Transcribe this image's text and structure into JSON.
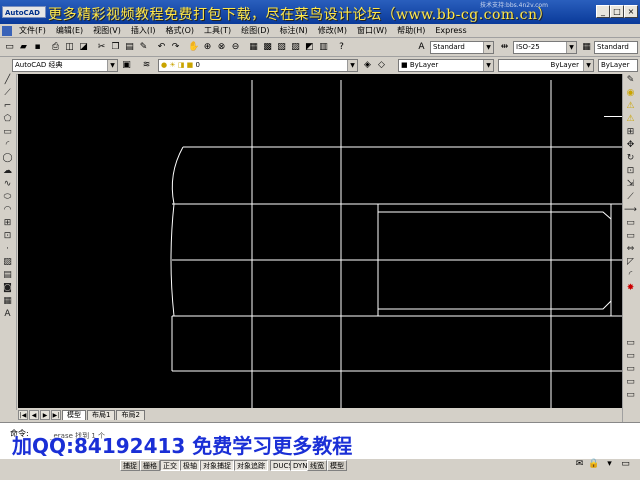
{
  "app": {
    "logo": "AutoCAD",
    "banner": "更多精彩视频教程免费打包下载，尽在菜鸟设计论坛（www.bb-cg.com.cn）",
    "watermark_top": "技术支持:bbs.4n2v.com",
    "window_buttons": [
      "_",
      "□",
      "×"
    ]
  },
  "menubar": {
    "items": [
      "文件(F)",
      "编辑(E)",
      "视图(V)",
      "插入(I)",
      "格式(O)",
      "工具(T)",
      "绘图(D)",
      "标注(N)",
      "修改(M)",
      "窗口(W)",
      "帮助(H)",
      "Express"
    ]
  },
  "toolbar_top": {
    "text_style": "Standard",
    "dim_style": "ISO-25",
    "table_style": "Standard"
  },
  "toolbar_second": {
    "workspace": "AutoCAD 经典",
    "layer": "0",
    "color": "ByLayer",
    "linetype": "ByLayer",
    "lineweight": "ByLayer"
  },
  "tabs": {
    "nav": [
      "|◀",
      "◀",
      "▶",
      "▶|"
    ],
    "items": [
      "模型",
      "布局1",
      "布局2"
    ]
  },
  "command": {
    "prompt": "命令:",
    "echo": "_erase 找到 1 个",
    "promo": "加QQ:84192413 免费学习更多教程"
  },
  "statusbar": {
    "buttons": [
      "捕捉",
      "栅格",
      "正交",
      "极轴",
      "对象捕捉",
      "对象追踪",
      "DUCS",
      "DYN",
      "线宽",
      "模型"
    ]
  },
  "colors": {
    "canvas": "#000000",
    "lines": "#ffffff",
    "banner": "#ffe84a",
    "promo": "#1a2fd6",
    "titlebar": "#0a3a9a"
  },
  "icons": {
    "left_tools": [
      "line-icon",
      "xline-icon",
      "polyline-icon",
      "polygon-icon",
      "rectangle-icon",
      "arc-icon",
      "circle-icon",
      "revcloud-icon",
      "spline-icon",
      "ellipse-icon",
      "ellipse-arc-icon",
      "insert-block-icon",
      "make-block-icon",
      "point-icon",
      "hatch-icon",
      "gradient-icon",
      "region-icon",
      "table-icon",
      "mtext-icon"
    ],
    "right_tools": [
      "erase-icon",
      "copy-icon",
      "mirror-icon",
      "offset-icon",
      "array-icon",
      "move-icon",
      "rotate-icon",
      "scale-icon",
      "stretch-icon",
      "trim-icon",
      "extend-icon",
      "break-point-icon",
      "break-icon",
      "join-icon",
      "chamfer-icon",
      "fillet-icon",
      "explode-icon"
    ]
  }
}
